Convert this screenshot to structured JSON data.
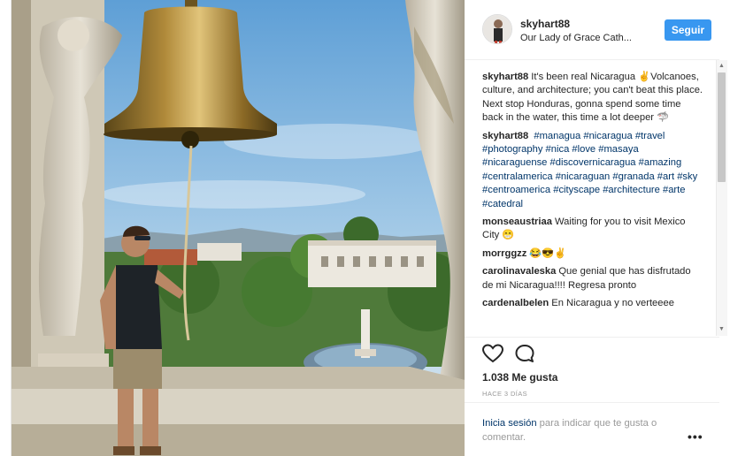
{
  "post": {
    "username": "skyhart88",
    "location": "Our Lady of Grace Cath...",
    "follow_label": "Seguir"
  },
  "comments": [
    {
      "author": "skyhart88",
      "text": "It's been real Nicaragua ✌️Volcanoes, culture, and architecture; you can't beat this place. Next stop Honduras, gonna spend some time back in the water, this time a lot deeper 🦈"
    },
    {
      "author": "skyhart88",
      "tags": [
        "#managua",
        "#nicaragua",
        "#travel",
        "#photography",
        "#nica",
        "#love",
        "#masaya",
        "#nicaraguense",
        "#discovernicaragua",
        "#amazing",
        "#centralamerica",
        "#nicaraguan",
        "#granada",
        "#art",
        "#sky",
        "#centroamerica",
        "#cityscape",
        "#architecture",
        "#arte",
        "#catedral"
      ]
    },
    {
      "author": "monseaustriaa",
      "text": "Waiting for you to visit Mexico City 😁"
    },
    {
      "author": "morrggzz",
      "text": "😂😎✌️"
    },
    {
      "author": "carolinavaleska",
      "text": "Que genial que has disfrutado de mi Nicaragua!!!! Regresa pronto"
    },
    {
      "author": "cardenalbelen",
      "text": "En Nicaragua y no verteeee"
    }
  ],
  "stats": {
    "likes": "1.038 Me gusta",
    "time_ago": "HACE 3 DÍAS"
  },
  "login_prompt": {
    "link": "Inicia sesión",
    "rest": " para indicar que te gusta o comentar."
  },
  "icons": {
    "like": "heart-icon",
    "comment": "comment-icon",
    "more": "more-options-icon"
  },
  "colors": {
    "accent": "#3897f0",
    "link": "#003569",
    "muted": "#999999"
  }
}
